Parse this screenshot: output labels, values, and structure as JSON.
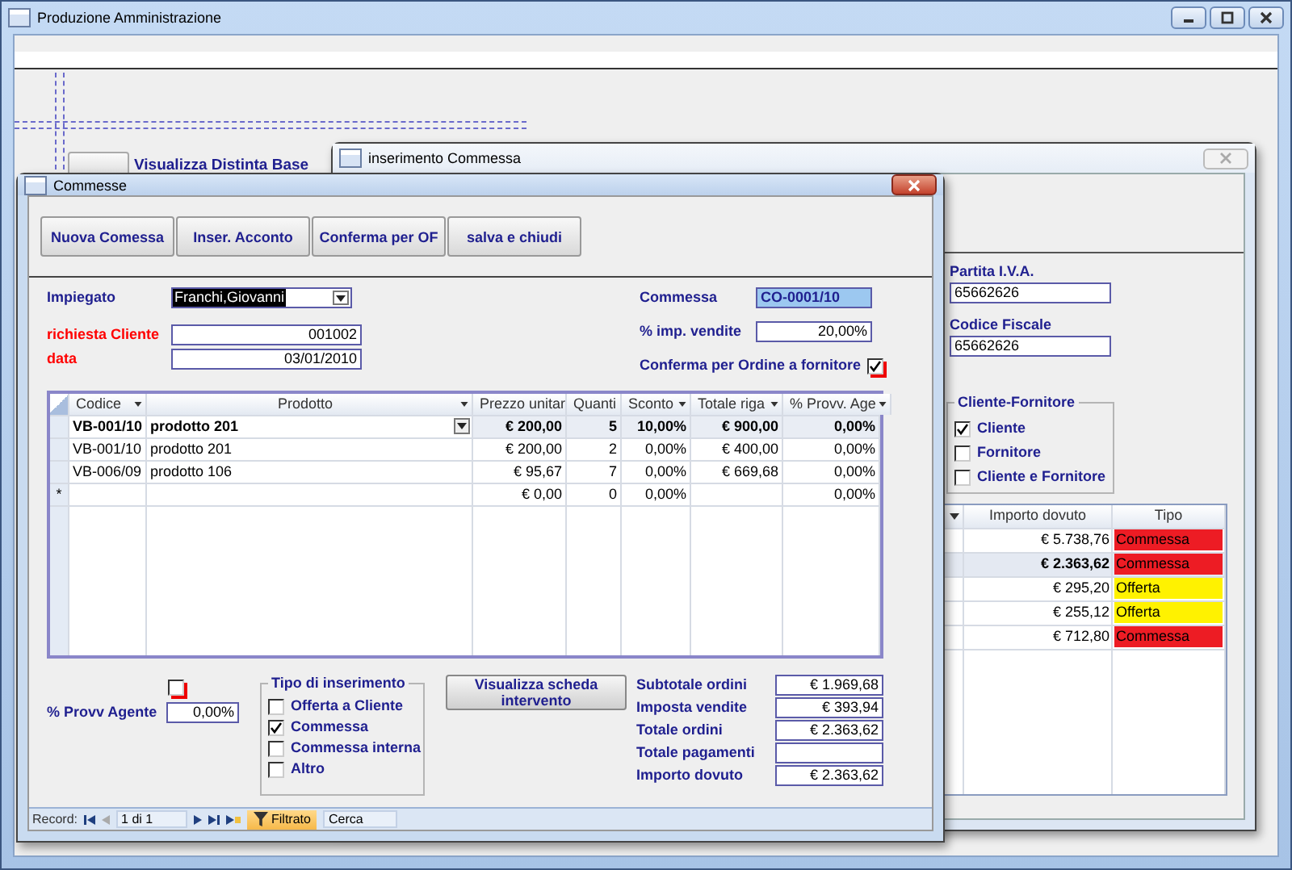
{
  "window": {
    "title": "Produzione Amministrazione"
  },
  "background_form": {
    "heading": "Visualizza Distinta Base"
  },
  "insert_window": {
    "title": "inserimento Commessa",
    "fields": [
      {
        "label": "Partita I.V.A.",
        "value": "65662626"
      },
      {
        "label": "Codice Fiscale",
        "value": "65662626"
      }
    ],
    "group": {
      "title": "Cliente-Fornitore",
      "options": [
        {
          "label": "Cliente",
          "checked": true
        },
        {
          "label": "Fornitore",
          "checked": false
        },
        {
          "label": "Cliente e Fornitore",
          "checked": false
        }
      ]
    },
    "table": {
      "columns": [
        "Importo dovuto",
        "Tipo"
      ],
      "rows": [
        {
          "importo": "€ 5.738,76",
          "tipo": "Commessa",
          "color": "#ed1c24",
          "selected": false
        },
        {
          "importo": "€ 2.363,62",
          "tipo": "Commessa",
          "color": "#ed1c24",
          "selected": true
        },
        {
          "importo": "€ 295,20",
          "tipo": "Offerta",
          "color": "#fff200",
          "selected": false
        },
        {
          "importo": "€ 255,12",
          "tipo": "Offerta",
          "color": "#fff200",
          "selected": false
        },
        {
          "importo": "€ 712,80",
          "tipo": "Commessa",
          "color": "#ed1c24",
          "selected": false
        }
      ]
    }
  },
  "commesse_window": {
    "title": "Commesse",
    "buttons": [
      "Nuova Comessa",
      "Inser.  Acconto",
      "Conferma per OF",
      "salva e chiudi"
    ],
    "left_fields": [
      {
        "label": "Impiegato",
        "value": "Franchi,Giovanni",
        "kind": "combo",
        "color": "#1f1f8f"
      },
      {
        "label": "richiesta Cliente",
        "value": "001002",
        "kind": "text",
        "color": "#ff0000"
      },
      {
        "label": "data",
        "value": "03/01/2010",
        "kind": "text",
        "color": "#ff0000"
      }
    ],
    "right_fields": [
      {
        "label": "Commessa",
        "value": "CO-0001/10",
        "kind": "highlight"
      },
      {
        "label": "% imp. vendite",
        "value": "20,00%",
        "kind": "text"
      },
      {
        "label": "Conferma per Ordine a fornitore",
        "checked": true,
        "kind": "checkbox"
      }
    ],
    "table": {
      "columns": [
        "Codice",
        "Prodotto",
        "Prezzo unitar",
        "Quanti",
        "Sconto",
        "Totale riga",
        "% Provv. Age"
      ],
      "rows": [
        {
          "cells": [
            "VB-001/10",
            "prodotto 201",
            "€ 200,00",
            "5",
            "10,00%",
            "€ 900,00",
            "0,00%"
          ],
          "current": true
        },
        {
          "cells": [
            "VB-001/10",
            "prodotto 201",
            "€ 200,00",
            "2",
            "0,00%",
            "€ 400,00",
            "0,00%"
          ],
          "current": false
        },
        {
          "cells": [
            "VB-006/09",
            "prodotto 106",
            "€ 95,67",
            "7",
            "0,00%",
            "€ 669,68",
            "0,00%"
          ],
          "current": false
        },
        {
          "selector": "*",
          "cells": [
            "",
            "",
            "€ 0,00",
            "0",
            "0,00%",
            "",
            "0,00%"
          ],
          "current": false
        }
      ]
    },
    "agent_flag": {
      "checked": false
    },
    "agent": {
      "label": "% Provv Agente",
      "value": "0,00%"
    },
    "type_group": {
      "title": "Tipo di inserimento",
      "options": [
        {
          "label": "Offerta a Cliente",
          "checked": false
        },
        {
          "label": "Commessa",
          "checked": true
        },
        {
          "label": "Commessa interna",
          "checked": false
        },
        {
          "label": "Altro",
          "checked": false
        }
      ]
    },
    "detail_button": "Visualizza scheda intervento",
    "totals": [
      {
        "label": "Subtotale ordini",
        "value": "€ 1.969,68"
      },
      {
        "label": "Imposta  vendite",
        "value": "€ 393,94"
      },
      {
        "label": "Totale ordini",
        "value": "€ 2.363,62"
      },
      {
        "label": "Totale pagamenti"
      },
      {
        "label": "Importo dovuto",
        "value": "€ 2.363,62"
      }
    ],
    "record_bar": {
      "label": "Record:",
      "position": "1 di 1",
      "filter": "Filtrato",
      "search": "Cerca"
    }
  }
}
